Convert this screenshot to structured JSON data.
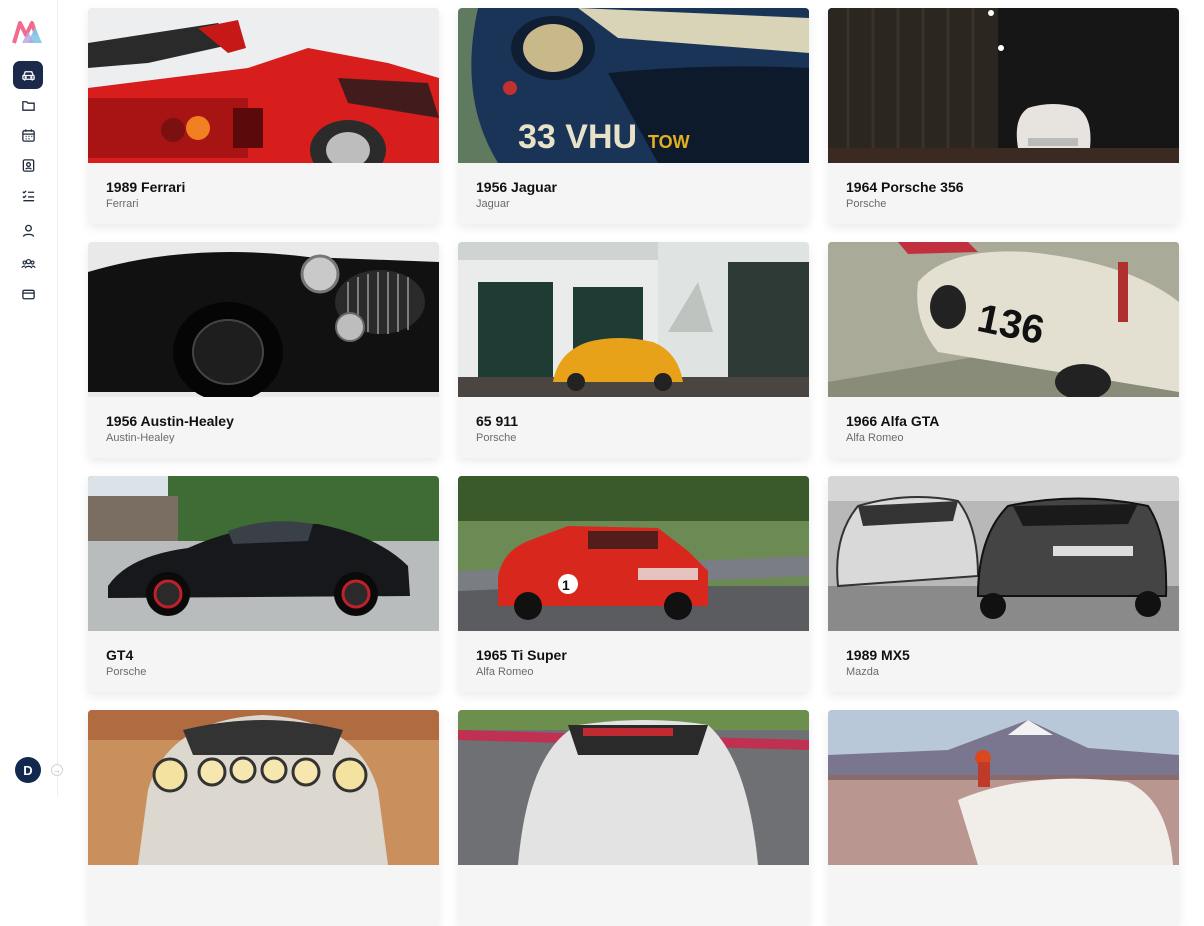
{
  "sidebar": {
    "items": [
      {
        "icon": "car-icon",
        "active": true
      },
      {
        "icon": "folder-icon",
        "active": false
      },
      {
        "icon": "calendar-icon",
        "active": false
      },
      {
        "icon": "contact-card-icon",
        "active": false
      },
      {
        "icon": "checklist-icon",
        "active": false
      },
      {
        "icon": "user-icon",
        "active": false
      },
      {
        "icon": "users-icon",
        "active": false
      },
      {
        "icon": "credit-card-icon",
        "active": false
      }
    ],
    "avatar_initial": "D"
  },
  "cars": [
    {
      "title": "1989 Ferrari",
      "make": "Ferrari"
    },
    {
      "title": "1956 Jaguar",
      "make": "Jaguar"
    },
    {
      "title": "1964 Porsche 356",
      "make": "Porsche"
    },
    {
      "title": "1956 Austin-Healey",
      "make": "Austin-Healey"
    },
    {
      "title": "65 911",
      "make": "Porsche"
    },
    {
      "title": "1966 Alfa GTA",
      "make": "Alfa Romeo"
    },
    {
      "title": "GT4",
      "make": "Porsche"
    },
    {
      "title": "1965 Ti Super",
      "make": "Alfa Romeo"
    },
    {
      "title": "1989 MX5",
      "make": "Mazda"
    },
    {
      "title": "",
      "make": ""
    },
    {
      "title": "",
      "make": ""
    },
    {
      "title": "",
      "make": ""
    }
  ],
  "colors": {
    "nav_active": "#1b2a4a",
    "avatar_bg": "#13284f"
  }
}
